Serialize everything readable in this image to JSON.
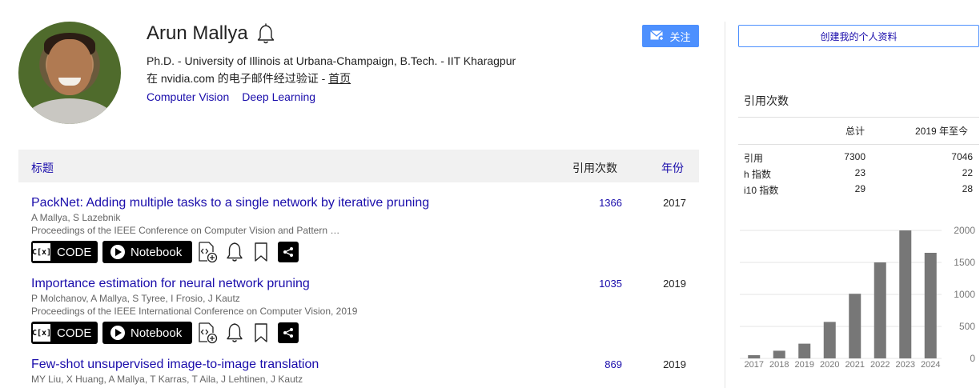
{
  "profile": {
    "name": "Arun Mallya",
    "affiliation": "Ph.D. - University of Illinois at Urbana-Champaign, B.Tech. - IIT Kharagpur",
    "verified_prefix": "在 nvidia.com 的电子邮件经过验证 -",
    "homepage_label": "首页",
    "interests": [
      "Computer Vision",
      "Deep Learning"
    ],
    "follow_label": "关注"
  },
  "table": {
    "col_title": "标题",
    "col_cited": "引用次数",
    "col_year": "年份",
    "badge_code_icon": "C[x]",
    "badge_code_label": "CODE",
    "badge_notebook_label": "Notebook",
    "rows": [
      {
        "title": "PackNet: Adding multiple tasks to a single network by iterative pruning",
        "authors": "A Mallya, S Lazebnik",
        "venue": "Proceedings of the IEEE Conference on Computer Vision and Pattern …",
        "cites": "1366",
        "year": "2017"
      },
      {
        "title": "Importance estimation for neural network pruning",
        "authors": "P Molchanov, A Mallya, S Tyree, I Frosio, J Kautz",
        "venue": "Proceedings of the IEEE International Conference on Computer Vision, 2019",
        "cites": "1035",
        "year": "2019"
      },
      {
        "title": "Few-shot unsupervised image-to-image translation",
        "authors": "MY Liu, X Huang, A Mallya, T Karras, T Aila, J Lehtinen, J Kautz",
        "venue": "",
        "cites": "869",
        "year": "2019"
      }
    ]
  },
  "sidebar": {
    "create_profile_label": "创建我的个人资料",
    "cited_by_heading": "引用次数",
    "col_all": "总计",
    "col_since": "2019 年至今",
    "stats": [
      {
        "label": "引用",
        "all": "7300",
        "since": "7046"
      },
      {
        "label": "h 指数",
        "all": "23",
        "since": "22"
      },
      {
        "label": "i10 指数",
        "all": "29",
        "since": "28"
      }
    ]
  },
  "chart_data": {
    "type": "bar",
    "categories": [
      "2017",
      "2018",
      "2019",
      "2020",
      "2021",
      "2022",
      "2023",
      "2024"
    ],
    "values": [
      50,
      120,
      230,
      570,
      1010,
      1500,
      2000,
      1650
    ],
    "ylim": [
      0,
      2000
    ],
    "yticks": [
      "0",
      "500",
      "1000",
      "1500",
      "2000"
    ],
    "bar_color": "#777777",
    "grid": true
  },
  "colors": {
    "link": "#1a0dab",
    "accent": "#4d90fe",
    "header_bg": "#f1f1f1"
  }
}
